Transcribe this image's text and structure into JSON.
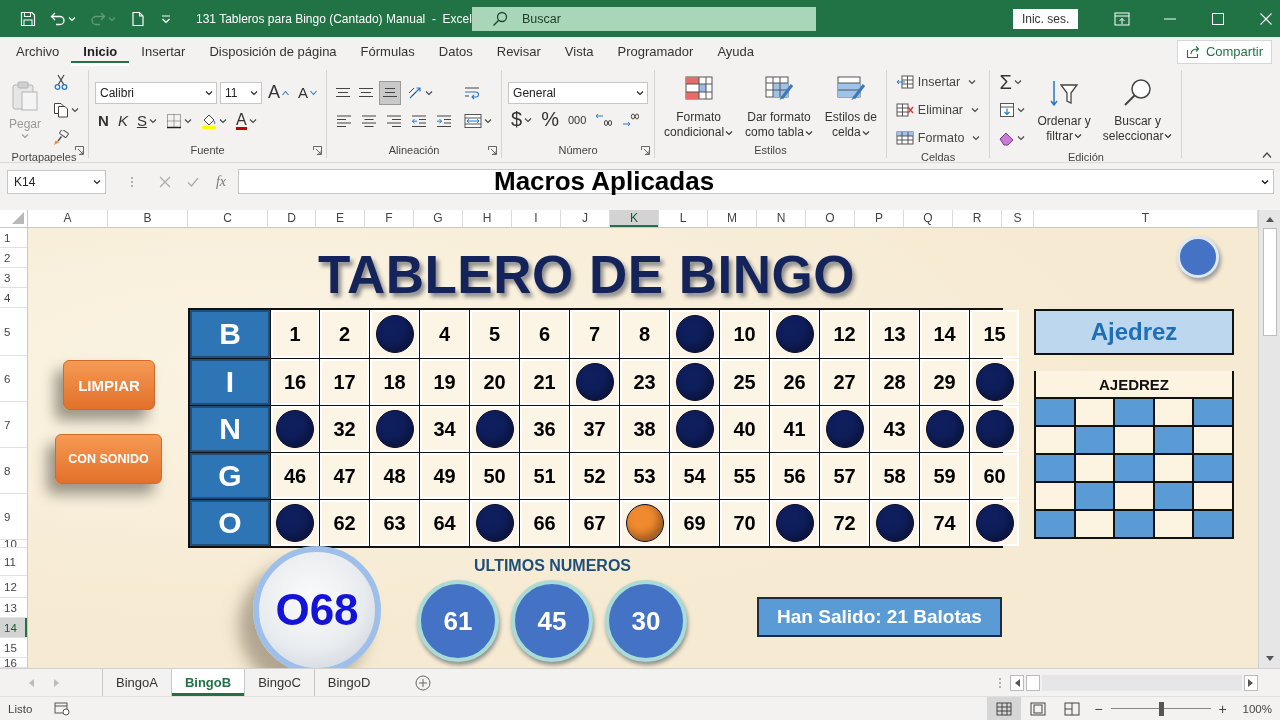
{
  "title_bar": {
    "quick_access": [
      {
        "kind": "save",
        "disabled": false
      },
      {
        "kind": "undo",
        "disabled": false,
        "caret": true
      },
      {
        "kind": "redo",
        "disabled": true,
        "caret": true
      },
      {
        "kind": "new-file",
        "disabled": false
      },
      {
        "kind": "customize",
        "disabled": false
      }
    ],
    "document_title": "131 Tableros para Bingo (Cantado) Manual  -  Excel",
    "search_placeholder": "Buscar",
    "sign_in": "Inic. ses."
  },
  "menu_tabs": [
    {
      "label": "Archivo",
      "selected": false
    },
    {
      "label": "Inicio",
      "selected": true
    },
    {
      "label": "Insertar",
      "selected": false
    },
    {
      "label": "Disposición de página",
      "selected": false
    },
    {
      "label": "Fórmulas",
      "selected": false
    },
    {
      "label": "Datos",
      "selected": false
    },
    {
      "label": "Revisar",
      "selected": false
    },
    {
      "label": "Vista",
      "selected": false
    },
    {
      "label": "Programador",
      "selected": false
    },
    {
      "label": "Ayuda",
      "selected": false
    }
  ],
  "share_button": "Compartir",
  "ribbon": {
    "groups": [
      {
        "label": "Portapapeles",
        "launcher": true,
        "sections": [
          {
            "tiers": [
              [
                {
                  "kind": "paste",
                  "lines": [
                    "Pegar"
                  ],
                  "disabled": true,
                  "caret": true
                }
              ]
            ]
          },
          {
            "tiers": [
              [
                {
                  "kind": "cut"
                }
              ],
              [
                {
                  "kind": "copy",
                  "caret": true
                }
              ],
              [
                {
                  "kind": "format-painter"
                }
              ]
            ]
          }
        ]
      },
      {
        "label": "Fuente",
        "launcher": true,
        "sections": [
          {
            "tiers": [
              [
                {
                  "kind": "font-name",
                  "value": "Calibri"
                },
                {
                  "kind": "font-size",
                  "value": "11"
                },
                {
                  "kind": "grow-font",
                  "text": "A"
                },
                {
                  "kind": "shrink-font",
                  "text": "A"
                }
              ],
              [
                {
                  "kind": "bold",
                  "text": "N"
                },
                {
                  "kind": "italic",
                  "text": "K"
                },
                {
                  "kind": "underline",
                  "text": "S",
                  "caret": true
                },
                {
                  "kind": "borders",
                  "caret": true
                },
                {
                  "kind": "fill-color",
                  "caret": true
                },
                {
                  "kind": "font-color",
                  "text": "A",
                  "caret": true
                }
              ]
            ]
          }
        ]
      },
      {
        "label": "Alineación",
        "launcher": true,
        "sections": [
          {
            "tiers": [
              [
                {
                  "kind": "align-top",
                  "selected": false
                },
                {
                  "kind": "align-middle",
                  "selected": false
                },
                {
                  "kind": "align-bottom",
                  "selected": true
                },
                {
                  "kind": "orientation",
                  "caret": true
                }
              ],
              [
                {
                  "kind": "align-left"
                },
                {
                  "kind": "align-center"
                },
                {
                  "kind": "align-right"
                },
                {
                  "kind": "outdent"
                },
                {
                  "kind": "indent"
                }
              ]
            ]
          },
          {
            "tiers": [
              [
                {
                  "kind": "wrap-text"
                }
              ],
              [
                {
                  "kind": "merge-center",
                  "caret": true
                }
              ]
            ]
          }
        ]
      },
      {
        "label": "Número",
        "launcher": true,
        "sections": [
          {
            "tiers": [
              [
                {
                  "kind": "number-format",
                  "value": "General"
                }
              ],
              [
                {
                  "kind": "currency",
                  "text": "$",
                  "caret": true
                },
                {
                  "kind": "percent",
                  "text": "%"
                },
                {
                  "kind": "thousands",
                  "text": "000"
                },
                {
                  "kind": "increase-decimal"
                },
                {
                  "kind": "decrease-decimal"
                }
              ]
            ]
          }
        ]
      },
      {
        "label": "Estilos",
        "sections": [
          {
            "tiers": [
              [
                {
                  "kind": "conditional-format",
                  "lines": [
                    "Formato",
                    "condicional"
                  ],
                  "caret": true
                }
              ]
            ]
          },
          {
            "tiers": [
              [
                {
                  "kind": "format-table",
                  "lines": [
                    "Dar formato",
                    "como tabla"
                  ],
                  "caret": true
                }
              ]
            ]
          },
          {
            "tiers": [
              [
                {
                  "kind": "cell-styles",
                  "lines": [
                    "Estilos de",
                    "celda"
                  ],
                  "caret": true
                }
              ]
            ]
          }
        ]
      },
      {
        "label": "Celdas",
        "sections": [
          {
            "tiers": [
              [
                {
                  "kind": "insert-cells",
                  "label": "Insertar",
                  "caret": true
                }
              ],
              [
                {
                  "kind": "delete-cells",
                  "label": "Eliminar",
                  "caret": true
                }
              ],
              [
                {
                  "kind": "format-cells",
                  "label": "Formato",
                  "caret": true
                }
              ]
            ]
          }
        ]
      },
      {
        "label": "Edición",
        "sections": [
          {
            "tiers": [
              [
                {
                  "kind": "autosum",
                  "text": "Σ",
                  "caret": true
                }
              ],
              [
                {
                  "kind": "fill",
                  "caret": true
                }
              ],
              [
                {
                  "kind": "clear",
                  "caret": true
                }
              ]
            ]
          },
          {
            "tiers": [
              [
                {
                  "kind": "sort-filter",
                  "lines": [
                    "Ordenar y",
                    "filtrar"
                  ],
                  "caret": true
                }
              ]
            ]
          },
          {
            "tiers": [
              [
                {
                  "kind": "find-select",
                  "lines": [
                    "Buscar y",
                    "seleccionar"
                  ],
                  "caret": true
                }
              ]
            ]
          }
        ]
      }
    ]
  },
  "formula_bar": {
    "name_box": "K14",
    "function_label": "fx",
    "formula": "Macros Aplicadas"
  },
  "column_headers": [
    {
      "label": "A",
      "selected": false
    },
    {
      "label": "B",
      "selected": false
    },
    {
      "label": "C",
      "selected": false
    },
    {
      "label": "D",
      "selected": false
    },
    {
      "label": "E",
      "selected": false
    },
    {
      "label": "F",
      "selected": false
    },
    {
      "label": "G",
      "selected": false
    },
    {
      "label": "H",
      "selected": false
    },
    {
      "label": "I",
      "selected": false
    },
    {
      "label": "J",
      "selected": false
    },
    {
      "label": "K",
      "selected": true
    },
    {
      "label": "L",
      "selected": false
    },
    {
      "label": "M",
      "selected": false
    },
    {
      "label": "N",
      "selected": false
    },
    {
      "label": "O",
      "selected": false
    },
    {
      "label": "P",
      "selected": false
    },
    {
      "label": "Q",
      "selected": false
    },
    {
      "label": "R",
      "selected": false
    },
    {
      "label": "S",
      "selected": false
    },
    {
      "label": "T",
      "selected": false
    }
  ],
  "row_headers": [
    {
      "label": "1",
      "selected": false
    },
    {
      "label": "2",
      "selected": false
    },
    {
      "label": "3",
      "selected": false
    },
    {
      "label": "4",
      "selected": false
    },
    {
      "label": "5",
      "selected": false
    },
    {
      "label": "6",
      "selected": false
    },
    {
      "label": "7",
      "selected": false
    },
    {
      "label": "8",
      "selected": false
    },
    {
      "label": "9",
      "selected": false
    },
    {
      "label": "10",
      "selected": false
    },
    {
      "label": "11",
      "selected": false
    },
    {
      "label": "12",
      "selected": false
    },
    {
      "label": "13",
      "selected": false
    },
    {
      "label": "14",
      "selected": true
    },
    {
      "label": "15",
      "selected": false
    },
    {
      "label": "16",
      "selected": false
    }
  ],
  "sheet": {
    "title": "TABLERO DE BINGO",
    "buttons": [
      "LIMPIAR",
      "CON SONIDO"
    ],
    "board": [
      {
        "letter": "B",
        "cells": [
          {
            "kind": "number",
            "text": "1"
          },
          {
            "kind": "number",
            "text": "2"
          },
          {
            "kind": "ball",
            "color": "#0f1f5e"
          },
          {
            "kind": "number",
            "text": "4"
          },
          {
            "kind": "number",
            "text": "5"
          },
          {
            "kind": "number",
            "text": "6"
          },
          {
            "kind": "number",
            "text": "7"
          },
          {
            "kind": "number",
            "text": "8"
          },
          {
            "kind": "ball",
            "color": "#0f1f5e"
          },
          {
            "kind": "number",
            "text": "10"
          },
          {
            "kind": "ball",
            "color": "#0f1f5e"
          },
          {
            "kind": "number",
            "text": "12"
          },
          {
            "kind": "number",
            "text": "13"
          },
          {
            "kind": "number",
            "text": "14"
          },
          {
            "kind": "number",
            "text": "15"
          }
        ]
      },
      {
        "letter": "I",
        "cells": [
          {
            "kind": "number",
            "text": "16"
          },
          {
            "kind": "number",
            "text": "17"
          },
          {
            "kind": "number",
            "text": "18"
          },
          {
            "kind": "number",
            "text": "19"
          },
          {
            "kind": "number",
            "text": "20"
          },
          {
            "kind": "number",
            "text": "21"
          },
          {
            "kind": "ball",
            "color": "#0f1f5e"
          },
          {
            "kind": "number",
            "text": "23"
          },
          {
            "kind": "ball",
            "color": "#0f1f5e"
          },
          {
            "kind": "number",
            "text": "25"
          },
          {
            "kind": "number",
            "text": "26"
          },
          {
            "kind": "number",
            "text": "27"
          },
          {
            "kind": "number",
            "text": "28"
          },
          {
            "kind": "number",
            "text": "29"
          },
          {
            "kind": "ball",
            "color": "#0f1f5e"
          }
        ]
      },
      {
        "letter": "N",
        "cells": [
          {
            "kind": "ball",
            "color": "#0f1f5e"
          },
          {
            "kind": "number",
            "text": "32"
          },
          {
            "kind": "ball",
            "color": "#0f1f5e"
          },
          {
            "kind": "number",
            "text": "34"
          },
          {
            "kind": "ball",
            "color": "#0f1f5e"
          },
          {
            "kind": "number",
            "text": "36"
          },
          {
            "kind": "number",
            "text": "37"
          },
          {
            "kind": "number",
            "text": "38"
          },
          {
            "kind": "ball",
            "color": "#0f1f5e"
          },
          {
            "kind": "number",
            "text": "40"
          },
          {
            "kind": "number",
            "text": "41"
          },
          {
            "kind": "ball",
            "color": "#0f1f5e"
          },
          {
            "kind": "number",
            "text": "43"
          },
          {
            "kind": "ball",
            "color": "#0f1f5e"
          },
          {
            "kind": "ball",
            "color": "#0f1f5e"
          }
        ]
      },
      {
        "letter": "G",
        "cells": [
          {
            "kind": "number",
            "text": "46"
          },
          {
            "kind": "number",
            "text": "47"
          },
          {
            "kind": "number",
            "text": "48"
          },
          {
            "kind": "number",
            "text": "49"
          },
          {
            "kind": "number",
            "text": "50"
          },
          {
            "kind": "number",
            "text": "51"
          },
          {
            "kind": "number",
            "text": "52"
          },
          {
            "kind": "number",
            "text": "53"
          },
          {
            "kind": "number",
            "text": "54"
          },
          {
            "kind": "number",
            "text": "55"
          },
          {
            "kind": "number",
            "text": "56"
          },
          {
            "kind": "number",
            "text": "57"
          },
          {
            "kind": "number",
            "text": "58"
          },
          {
            "kind": "number",
            "text": "59"
          },
          {
            "kind": "number",
            "text": "60"
          }
        ]
      },
      {
        "letter": "O",
        "cells": [
          {
            "kind": "ball",
            "color": "#0f1f5e"
          },
          {
            "kind": "number",
            "text": "62"
          },
          {
            "kind": "number",
            "text": "63"
          },
          {
            "kind": "number",
            "text": "64"
          },
          {
            "kind": "ball",
            "color": "#0f1f5e"
          },
          {
            "kind": "number",
            "text": "66"
          },
          {
            "kind": "number",
            "text": "67"
          },
          {
            "kind": "ball",
            "color": "#ef8a2e"
          },
          {
            "kind": "number",
            "text": "69"
          },
          {
            "kind": "number",
            "text": "70"
          },
          {
            "kind": "ball",
            "color": "#0f1f5e"
          },
          {
            "kind": "number",
            "text": "72"
          },
          {
            "kind": "ball",
            "color": "#0f1f5e"
          },
          {
            "kind": "number",
            "text": "74"
          },
          {
            "kind": "ball",
            "color": "#0f1f5e"
          }
        ]
      }
    ],
    "pattern_button": "Ajedrez",
    "pattern": {
      "title": "AJEDREZ",
      "rows": [
        [
          {
            "filled": true
          },
          {
            "filled": false
          },
          {
            "filled": true
          },
          {
            "filled": false
          },
          {
            "filled": true
          }
        ],
        [
          {
            "filled": false
          },
          {
            "filled": true
          },
          {
            "filled": false
          },
          {
            "filled": true
          },
          {
            "filled": false
          }
        ],
        [
          {
            "filled": true
          },
          {
            "filled": false
          },
          {
            "filled": true
          },
          {
            "filled": false
          },
          {
            "filled": true
          }
        ],
        [
          {
            "filled": false
          },
          {
            "filled": true
          },
          {
            "filled": false
          },
          {
            "filled": true
          },
          {
            "filled": false
          }
        ],
        [
          {
            "filled": true
          },
          {
            "filled": false
          },
          {
            "filled": true
          },
          {
            "filled": false
          },
          {
            "filled": true
          }
        ]
      ]
    },
    "current_ball": "O68",
    "last_numbers": {
      "title": "ULTIMOS NUMEROS",
      "balls": [
        "61",
        "45",
        "30"
      ]
    },
    "drawn_count": "Han Salido: 21 Balotas"
  },
  "sheet_tabs": [
    {
      "label": "BingoA",
      "selected": false
    },
    {
      "label": "BingoB",
      "selected": true
    },
    {
      "label": "BingoC",
      "selected": false
    },
    {
      "label": "BingoD",
      "selected": false
    }
  ],
  "status_bar": {
    "text": "Listo",
    "views": [
      {
        "kind": "normal",
        "selected": true
      },
      {
        "kind": "page-layout",
        "selected": false
      },
      {
        "kind": "page-break",
        "selected": false
      }
    ],
    "zoom": {
      "minus": "−",
      "plus": "+",
      "level": 0.5,
      "label": "100%"
    }
  }
}
